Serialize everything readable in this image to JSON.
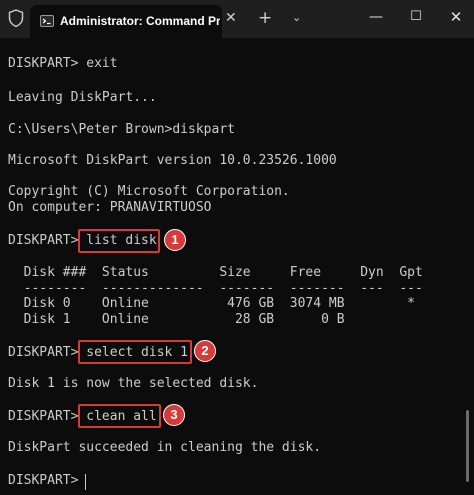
{
  "window": {
    "tab_title": "Administrator: Command Pro",
    "tab_close": "✕",
    "new_tab": "+",
    "dropdown": "⌄",
    "minimize": "—",
    "maximize": "☐",
    "close": "✕"
  },
  "terminal": {
    "lines": [
      "DISKPART> exit",
      "Leaving DiskPart...",
      "C:\\Users\\Peter Brown>diskpart",
      "Microsoft DiskPart version 10.0.23526.1000",
      "Copyright (C) Microsoft Corporation.",
      "On computer: PRANAVIRTUOSO",
      "DISKPART> list disk",
      "  Disk ###  Status         Size     Free     Dyn  Gpt",
      "  --------  -------------  -------  -------  ---  ---",
      "  Disk 0    Online          476 GB  3074 MB        *",
      "  Disk 1    Online           28 GB      0 B",
      "DISKPART> select disk 1",
      "Disk 1 is now the selected disk.",
      "DISKPART> clean all",
      "DiskPart succeeded in cleaning the disk.",
      "DISKPART> "
    ]
  },
  "annotations": [
    "1",
    "2",
    "3"
  ]
}
